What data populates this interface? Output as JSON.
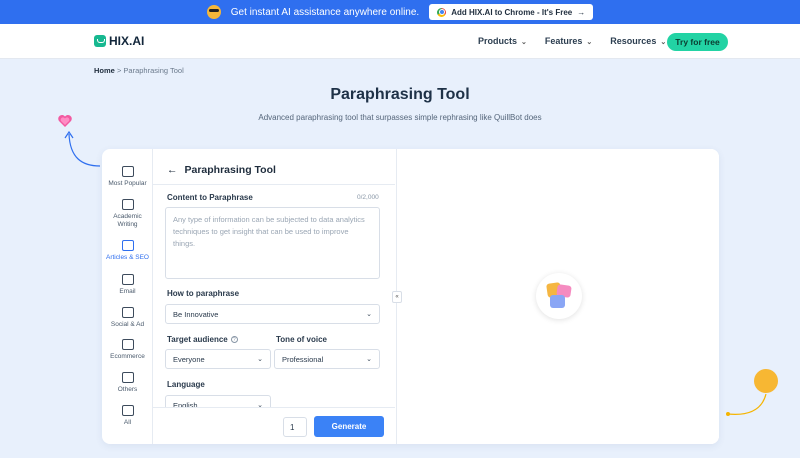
{
  "promo": {
    "text": "Get instant AI assistance anywhere online.",
    "button_label": "Add HIX.AI to Chrome - It's Free"
  },
  "nav": {
    "logo_text": "HIX.AI",
    "links": [
      "Products",
      "Features",
      "Resources"
    ],
    "cta_label": "Try for free"
  },
  "breadcrumb": {
    "home": "Home",
    "separator": ">",
    "current": "Paraphrasing Tool"
  },
  "page": {
    "title": "Paraphrasing Tool",
    "subtitle": "Advanced paraphrasing tool that surpasses simple rephrasing like QuillBot does"
  },
  "sidebar": {
    "items": [
      {
        "label": "Most Popular",
        "icon": "crown-icon"
      },
      {
        "label": "Academic Writing",
        "icon": "academic-icon"
      },
      {
        "label": "Articles & SEO",
        "icon": "article-icon",
        "active": true
      },
      {
        "label": "Email",
        "icon": "mail-icon"
      },
      {
        "label": "Social & Ad",
        "icon": "heart-icon"
      },
      {
        "label": "Ecommerce",
        "icon": "cart-icon"
      },
      {
        "label": "Others",
        "icon": "more-icon"
      },
      {
        "label": "All",
        "icon": "grid-icon"
      }
    ]
  },
  "tool": {
    "header": "Paraphrasing Tool",
    "content_label": "Content to Paraphrase",
    "char_count": "0/2,000",
    "content_placeholder": "Any type of information can be subjected to data analytics techniques to get insight that can be used to improve things.",
    "how_label": "How to paraphrase",
    "how_value": "Be Innovative",
    "audience_label": "Target audience",
    "audience_value": "Everyone",
    "tone_label": "Tone of voice",
    "tone_value": "Professional",
    "language_label": "Language",
    "language_value": "English",
    "quantity": "1",
    "generate_label": "Generate"
  },
  "colors": {
    "accent": "#3b82f6",
    "brand": "#22d3a4",
    "banner": "#2f6fef"
  }
}
